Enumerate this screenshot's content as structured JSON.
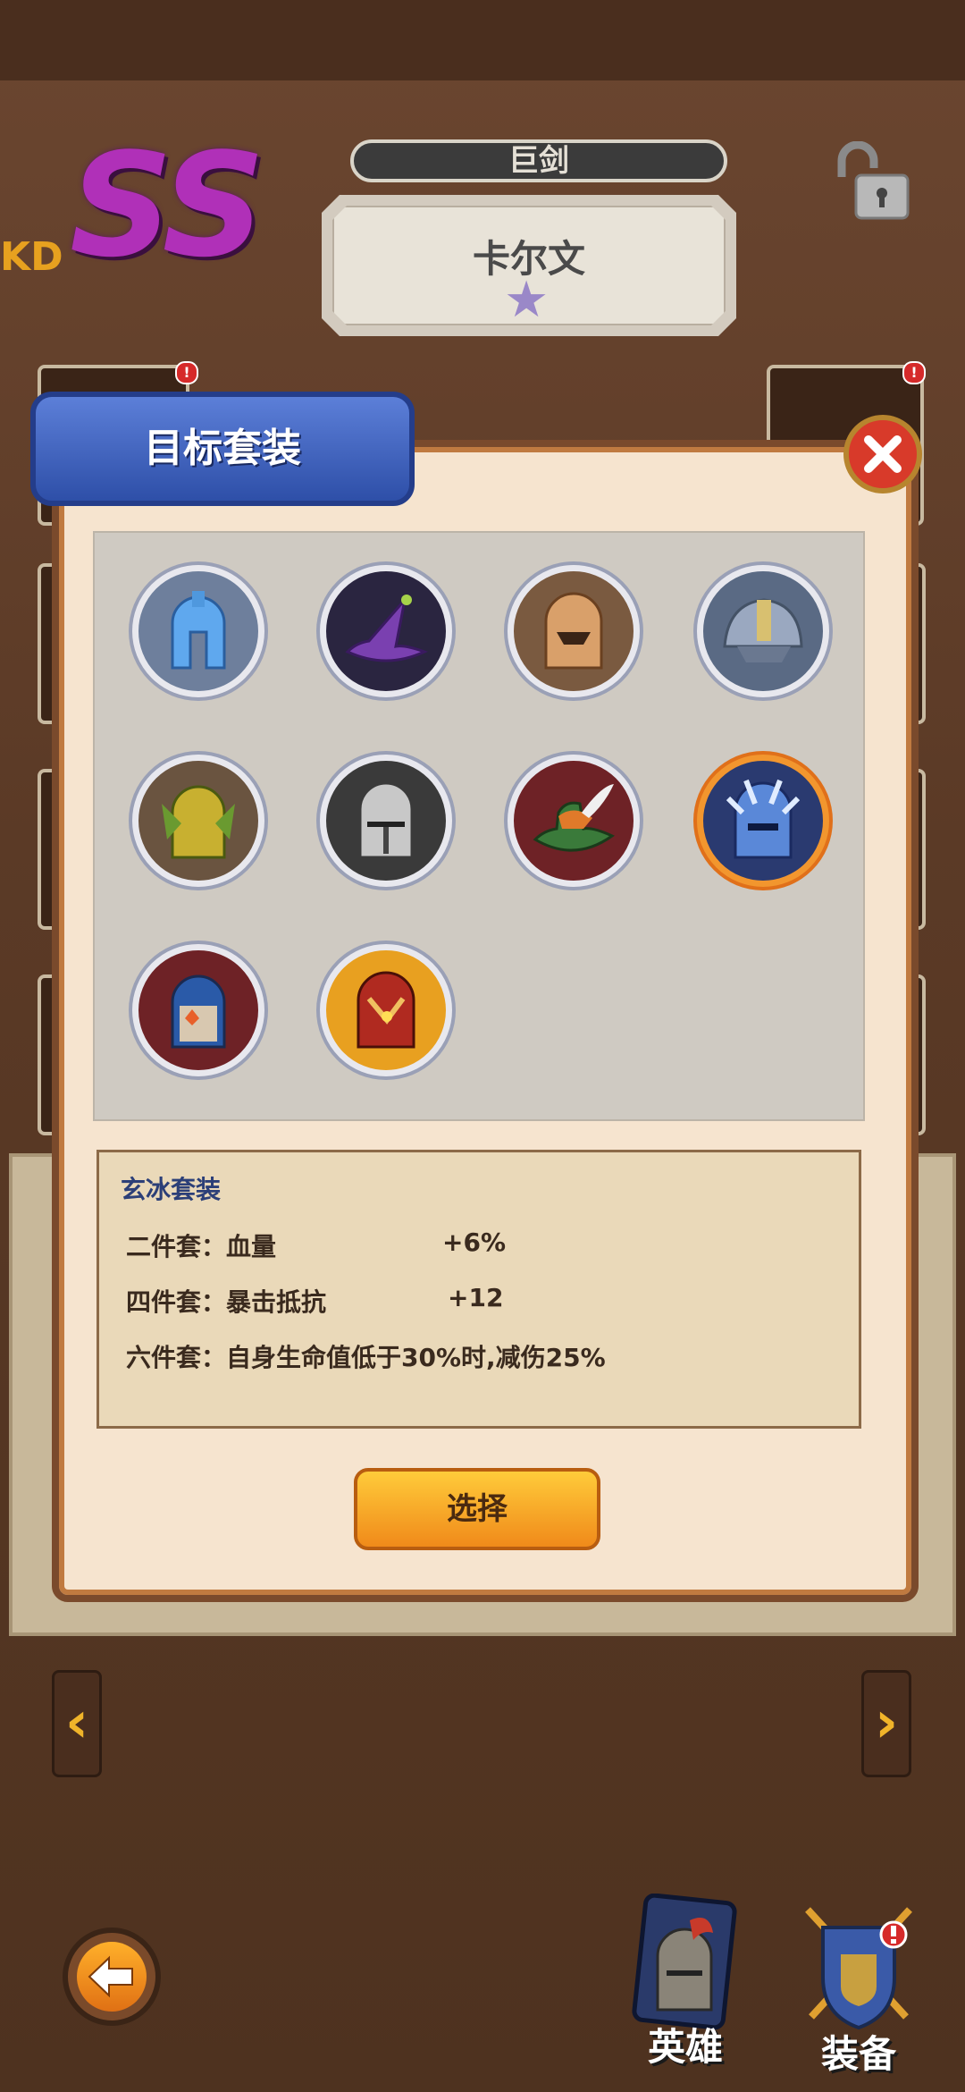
{
  "header": {
    "rank_prefix": "KD",
    "rank": "SS",
    "weapon_type": "巨剑",
    "hero_name": "卡尔文",
    "star_icon": "star-icon",
    "lock_icon": "unlocked-padlock-icon"
  },
  "modal": {
    "title": "目标套装",
    "close_icon": "close-icon",
    "sets": [
      {
        "icon": "blue-spartan-helmet-icon",
        "selected": false
      },
      {
        "icon": "purple-wizard-hat-icon",
        "selected": false
      },
      {
        "icon": "bronze-winged-helmet-icon",
        "selected": false
      },
      {
        "icon": "steel-sallet-helmet-icon",
        "selected": false
      },
      {
        "icon": "gold-green-knight-helmet-icon",
        "selected": false
      },
      {
        "icon": "silver-great-helm-icon",
        "selected": false
      },
      {
        "icon": "feathered-hunter-hat-icon",
        "selected": false
      },
      {
        "icon": "ice-knight-helmet-icon",
        "selected": true
      },
      {
        "icon": "red-blue-knight-helmet-icon",
        "selected": false
      },
      {
        "icon": "crimson-gold-helmet-icon",
        "selected": false
      }
    ],
    "info": {
      "set_name": "玄冰套装",
      "bonuses": [
        {
          "label": "二件套：血量",
          "value": "+6%"
        },
        {
          "label": "四件套：暴击抵抗",
          "value": "+12"
        },
        {
          "label": "六件套：自身生命值低于30%时,减伤25%",
          "value": ""
        }
      ]
    },
    "select_label": "选择"
  },
  "nav": {
    "prev_icon": "chevron-left-icon",
    "next_icon": "chevron-right-icon",
    "back_icon": "back-arrow-icon",
    "hero_label": "英雄",
    "equip_label": "装备"
  },
  "colors": {
    "accent_orange": "#f2962e",
    "title_blue": "#2e4fa8",
    "rank_purple": "#b030b8"
  }
}
